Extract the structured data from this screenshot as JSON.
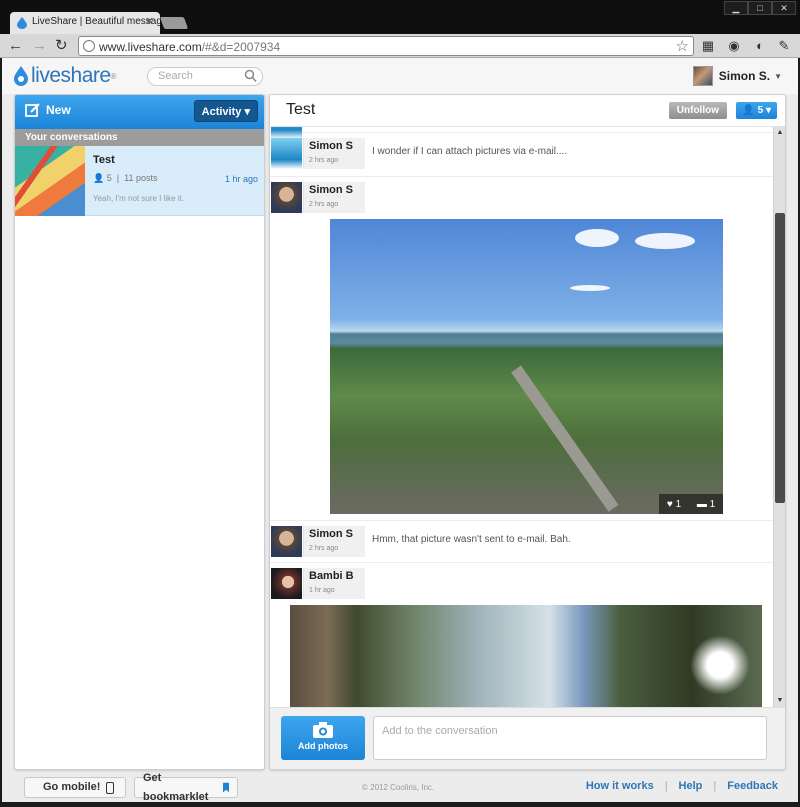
{
  "browser": {
    "tab_title": "LiveShare | Beautiful message",
    "url_host": "www.liveshare.com",
    "url_path": "/#&d=2007934"
  },
  "header": {
    "logo": "liveshare",
    "search_placeholder": "Search",
    "user_name": "Simon S."
  },
  "sidebar": {
    "new_label": "New",
    "activity_label": "Activity",
    "section_label": "Your conversations",
    "conversations": [
      {
        "title": "Test",
        "members": "5",
        "posts": "11 posts",
        "time": "1 hr ago",
        "snippet": "Yeah, I'm not sure I like it."
      }
    ]
  },
  "conversation": {
    "title": "Test",
    "unfollow_label": "Unfollow",
    "members_count": "5",
    "posts": [
      {
        "author": "Simon S",
        "time": "2 hrs ago",
        "text": "I wonder if I can attach pictures via e-mail...."
      },
      {
        "author": "Simon S",
        "time": "2 hrs ago",
        "likes": "1",
        "comments": "1"
      },
      {
        "author": "Simon S",
        "time": "2 hrs ago",
        "text": "Hmm, that picture wasn't sent to e-mail. Bah."
      },
      {
        "author": "Bambi B",
        "time": "1 hr ago"
      }
    ],
    "add_photos_label": "Add photos",
    "compose_placeholder": "Add to the conversation"
  },
  "footer": {
    "go_mobile": "Go mobile!",
    "bookmarklet": "Get bookmarklet",
    "copyright": "© 2012 Cooliris, Inc.",
    "how_it_works": "How it works",
    "help": "Help",
    "feedback": "Feedback"
  },
  "colors": {
    "brand_blue": "#1c84d6",
    "link_blue": "#2d76b9"
  }
}
